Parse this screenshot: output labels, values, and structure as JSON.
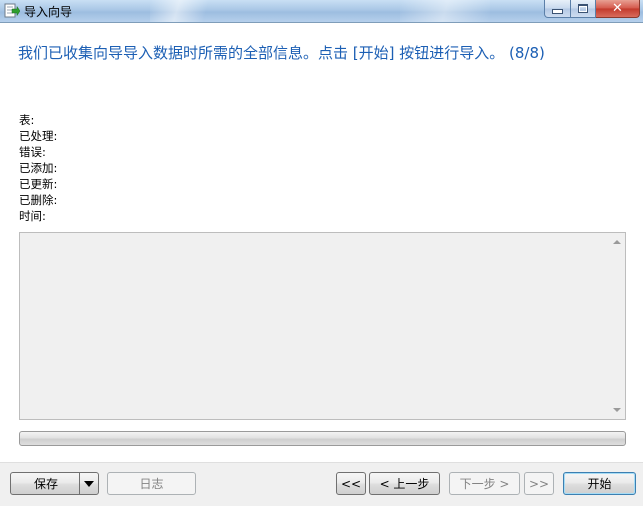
{
  "window": {
    "title": "导入向导",
    "icon": "import-wizard-icon",
    "controls": [
      "minimize",
      "maximize",
      "close"
    ]
  },
  "heading": "我们已收集向导导入数据时所需的全部信息。点击 [开始] 按钮进行导入。 (8/8)",
  "stats": {
    "table_label": "表:",
    "processed_label": "已处理:",
    "errors_label": "错误:",
    "added_label": "已添加:",
    "updated_label": "已更新:",
    "deleted_label": "已删除:",
    "time_label": "时间:"
  },
  "progress": {
    "value": 0
  },
  "buttons": {
    "save": "保存",
    "log": "日志",
    "first": "<<",
    "previous": "< 上一步",
    "next": "下一步 >",
    "last": ">>",
    "start": "开始"
  },
  "colors": {
    "heading": "#1c5fb4",
    "titlebar": "#a9c7e6",
    "close_button": "#c2392b"
  }
}
